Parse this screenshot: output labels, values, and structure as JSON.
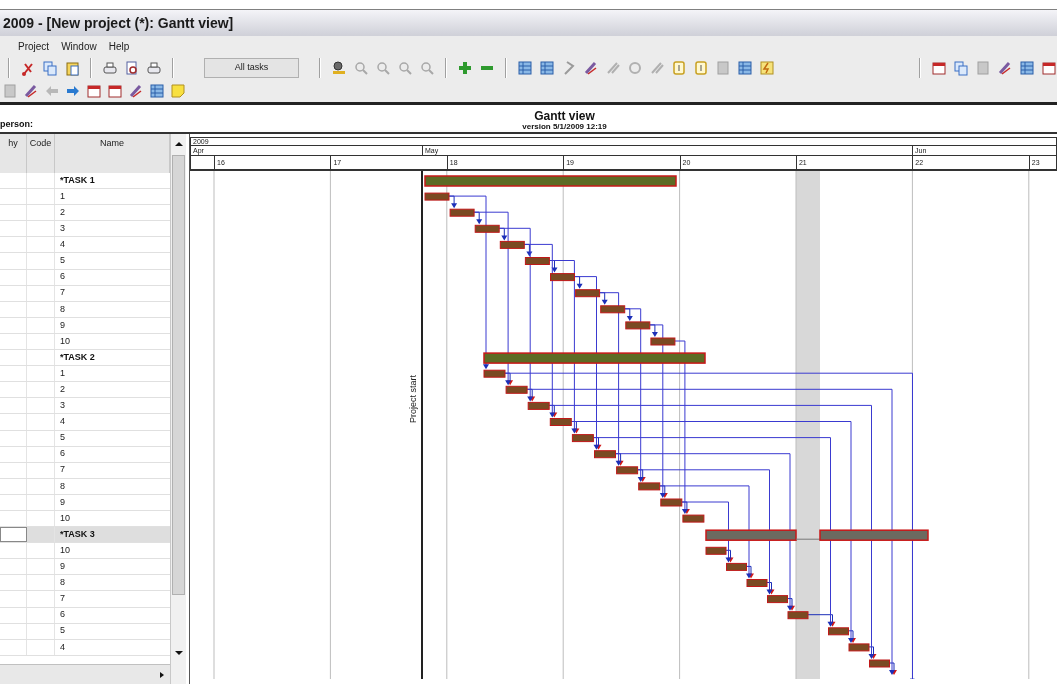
{
  "window": {
    "title": "2009 - [New project (*): Gantt view]"
  },
  "menu": [
    {
      "label": "Project"
    },
    {
      "label": "Window"
    },
    {
      "label": "Help"
    }
  ],
  "toolbar": {
    "filter_button": "All tasks"
  },
  "report": {
    "title": "Gantt view",
    "subtitle": "version 5/1/2009 12:19",
    "person_label": "person:"
  },
  "table": {
    "columns": [
      "hy",
      "Code",
      "Name"
    ],
    "rows": [
      {
        "name": "*TASK 1",
        "kind": "summary",
        "selected": false
      },
      {
        "name": "1",
        "kind": "task",
        "selected": false
      },
      {
        "name": "2",
        "kind": "task",
        "selected": false
      },
      {
        "name": "3",
        "kind": "task",
        "selected": false
      },
      {
        "name": "4",
        "kind": "task",
        "selected": false
      },
      {
        "name": "5",
        "kind": "task",
        "selected": false
      },
      {
        "name": "6",
        "kind": "task",
        "selected": false
      },
      {
        "name": "7",
        "kind": "task",
        "selected": false
      },
      {
        "name": "8",
        "kind": "task",
        "selected": false
      },
      {
        "name": "9",
        "kind": "task",
        "selected": false
      },
      {
        "name": "10",
        "kind": "task",
        "selected": false
      },
      {
        "name": "*TASK 2",
        "kind": "summary",
        "selected": false
      },
      {
        "name": "1",
        "kind": "task",
        "selected": false
      },
      {
        "name": "2",
        "kind": "task",
        "selected": false
      },
      {
        "name": "3",
        "kind": "task",
        "selected": false
      },
      {
        "name": "4",
        "kind": "task",
        "selected": false
      },
      {
        "name": "5",
        "kind": "task",
        "selected": false
      },
      {
        "name": "6",
        "kind": "task",
        "selected": false
      },
      {
        "name": "7",
        "kind": "task",
        "selected": false
      },
      {
        "name": "8",
        "kind": "task",
        "selected": false
      },
      {
        "name": "9",
        "kind": "task",
        "selected": false
      },
      {
        "name": "10",
        "kind": "task",
        "selected": false
      },
      {
        "name": "*TASK 3",
        "kind": "summary",
        "selected": true
      },
      {
        "name": "10",
        "kind": "task",
        "selected": false
      },
      {
        "name": "9",
        "kind": "task",
        "selected": false
      },
      {
        "name": "8",
        "kind": "task",
        "selected": false
      },
      {
        "name": "7",
        "kind": "task",
        "selected": false
      },
      {
        "name": "6",
        "kind": "task",
        "selected": false
      },
      {
        "name": "5",
        "kind": "task",
        "selected": false
      },
      {
        "name": "4",
        "kind": "task",
        "selected": false
      }
    ]
  },
  "timeline": {
    "year": "2009",
    "months": [
      "Apr",
      "May",
      "Jun"
    ],
    "days": [
      "16",
      "17",
      "18",
      "19",
      "20",
      "21",
      "22",
      "23"
    ]
  },
  "chart": {
    "marker": "Project start"
  }
}
